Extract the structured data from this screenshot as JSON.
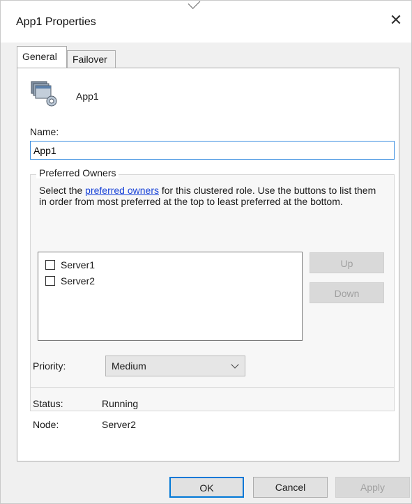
{
  "window": {
    "title": "App1 Properties"
  },
  "tabs": [
    {
      "label": "General"
    },
    {
      "label": "Failover"
    }
  ],
  "app": {
    "name": "App1"
  },
  "name_field": {
    "label": "Name:",
    "value": "App1"
  },
  "preferred_owners": {
    "title": "Preferred Owners",
    "desc_prefix": "Select the ",
    "desc_link": "preferred owners",
    "desc_suffix": " for this clustered role. Use the buttons to list them in order from most preferred at the top to least preferred at the bottom.",
    "owners": [
      {
        "label": "Server1",
        "checked": false
      },
      {
        "label": "Server2",
        "checked": false
      }
    ],
    "up_label": "Up",
    "down_label": "Down"
  },
  "priority": {
    "label": "Priority:",
    "selected": "Medium"
  },
  "status": {
    "label": "Status:",
    "value": "Running"
  },
  "node": {
    "label": "Node:",
    "value": "Server2"
  },
  "buttons": {
    "ok": "OK",
    "cancel": "Cancel",
    "apply": "Apply"
  }
}
